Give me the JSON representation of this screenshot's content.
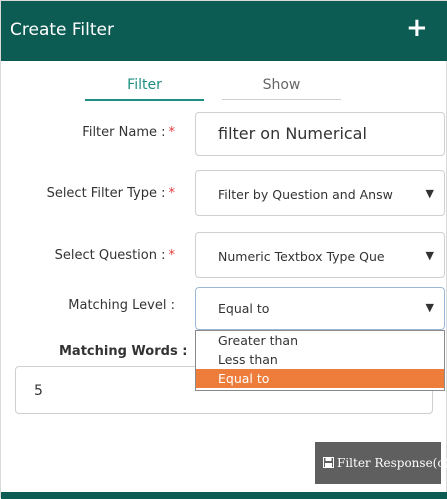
{
  "header": {
    "title": "Create Filter",
    "add_icon": "plus-icon"
  },
  "tabs": [
    {
      "label": "Filter",
      "active": true
    },
    {
      "label": "Show",
      "active": false
    }
  ],
  "form": {
    "filter_name": {
      "label": "Filter Name :",
      "required_mark": "*",
      "value": "filter on Numerical"
    },
    "filter_type": {
      "label": "Select Filter Type :",
      "required_mark": "*",
      "value": "Filter by Question and Answ",
      "caret": "▼"
    },
    "question": {
      "label": "Select Question :",
      "required_mark": "*",
      "value": "Numeric Textbox Type Que",
      "caret": "▼"
    },
    "matching_level": {
      "label": "Matching Level :",
      "value": "Equal to",
      "caret": "▼",
      "options": [
        "Greater than",
        "Less than",
        "Equal to"
      ],
      "selected_index": 2
    },
    "matching_words": {
      "label": "Matching Words :",
      "value": "5"
    }
  },
  "actions": {
    "filter_response_label": "Filter Response(c)",
    "filter_response_icon": "save-icon"
  },
  "colors": {
    "header_bg": "#0d5c54",
    "accent": "#1e8f82",
    "required": "#e03b3b",
    "dropdown_selected": "#ee7d3b",
    "button_bg": "#5f5f5f"
  }
}
